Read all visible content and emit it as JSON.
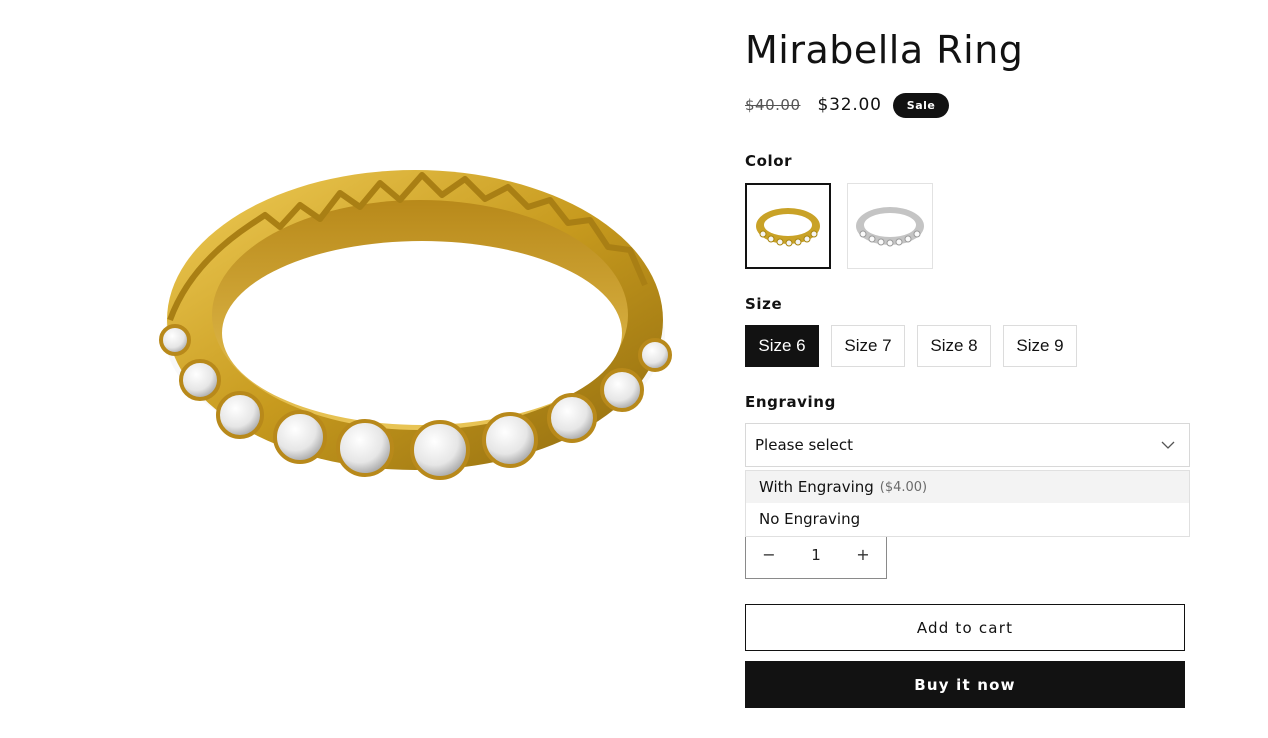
{
  "product": {
    "title": "Mirabella Ring",
    "price_old": "$40.00",
    "price_new": "$32.00",
    "badge": "Sale",
    "image_icon": "gold-ring-photo"
  },
  "color": {
    "label": "Color",
    "options": [
      {
        "name": "gold-swatch",
        "color": "#c9a227",
        "selected": true
      },
      {
        "name": "silver-swatch",
        "color": "#c0c0c0",
        "selected": false
      }
    ]
  },
  "size": {
    "label": "Size",
    "options": [
      "Size 6",
      "Size 7",
      "Size 8",
      "Size 9"
    ],
    "selected": "Size 6"
  },
  "engraving": {
    "label": "Engraving",
    "placeholder": "Please select",
    "options": [
      {
        "label": "With Engraving",
        "extra": "($4.00)"
      },
      {
        "label": "No Engraving",
        "extra": ""
      }
    ]
  },
  "quantity": {
    "minus": "−",
    "value": "1",
    "plus": "+"
  },
  "buttons": {
    "add_to_cart": "Add to cart",
    "buy_now": "Buy it now"
  },
  "colors": {
    "primary": "#121212",
    "gold": "#c9a227",
    "border": "#dcdcdc"
  }
}
